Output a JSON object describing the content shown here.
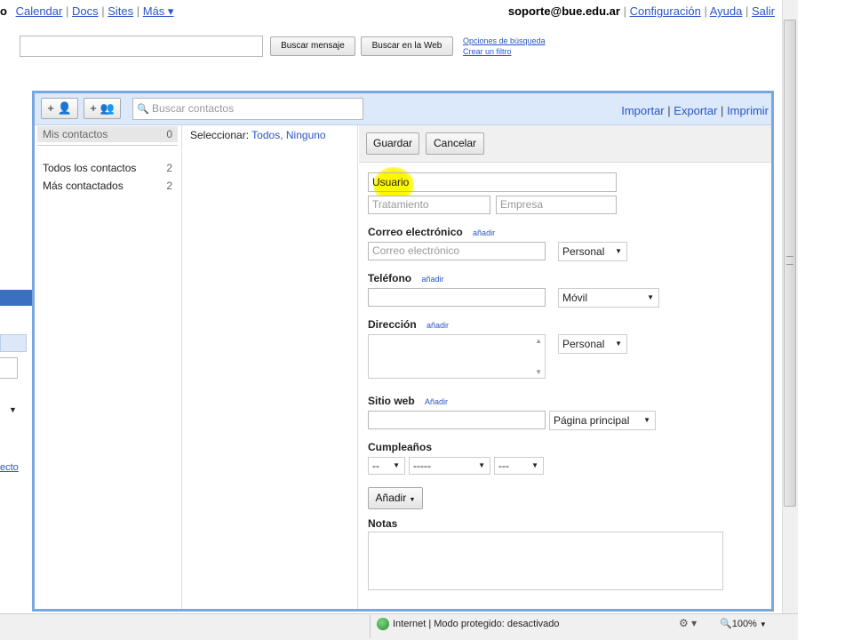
{
  "topnav": {
    "first": "o",
    "links": [
      "Calendar",
      "Docs",
      "Sites",
      "Más ▾"
    ],
    "email": "soporte@bue.edu.ar",
    "right_links": [
      "Configuración",
      "Ayuda",
      "Salir"
    ]
  },
  "search": {
    "buscar_mensaje": "Buscar mensaje",
    "buscar_web": "Buscar en la Web",
    "opciones": "Opciones de búsqueda",
    "crear_filtro": "Crear un filtro"
  },
  "contacts": {
    "search_placeholder": "Buscar contactos",
    "add_contact_btn": "+ 👤",
    "add_group_btn": "+ 👥",
    "header_links": [
      "Importar",
      "Exportar",
      "Imprimir"
    ],
    "my_contacts": {
      "label": "Mis contactos",
      "count": "0"
    },
    "groups": [
      {
        "label": "Todos los contactos",
        "count": "2"
      },
      {
        "label": "Más contactados",
        "count": "2"
      }
    ],
    "select": {
      "label": "Seleccionar:",
      "all": "Todos",
      "none": "Ninguno"
    }
  },
  "editor": {
    "save": "Guardar",
    "cancel": "Cancelar",
    "name_value": "Usuario",
    "title_placeholder": "Tratamiento",
    "company_placeholder": "Empresa",
    "add_link": "añadir",
    "email_label": "Correo electrónico",
    "email_placeholder": "Correo electrónico",
    "email_type": "Personal",
    "phone_label": "Teléfono",
    "phone_type": "Móvil",
    "address_label": "Dirección",
    "address_type": "Personal",
    "web_label": "Sitio web",
    "web_add": "Añadir",
    "web_type": "Página principal",
    "birthday_label": "Cumpleaños",
    "bday_day": "--",
    "bday_month": "-----",
    "bday_year": "---",
    "add_button": "Añadir",
    "notes_label": "Notas"
  },
  "statusbar": {
    "zone": "Internet | Modo protegido: desactivado",
    "zoom": "100%"
  },
  "left_remnants": {
    "link_fragment": "ecto"
  }
}
